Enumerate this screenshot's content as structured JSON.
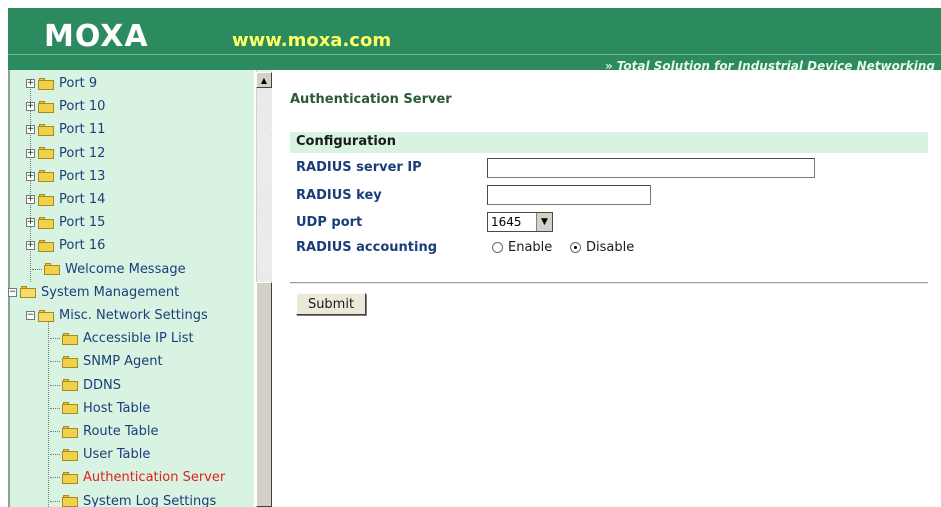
{
  "banner": {
    "logo_text": "MOXA",
    "url": "www.moxa.com",
    "tagline_arrows": "»",
    "tagline": "Total Solution for Industrial Device Networking"
  },
  "tree": {
    "items": [
      {
        "label": "Port 9",
        "active": false
      },
      {
        "label": "Port 10",
        "active": false
      },
      {
        "label": "Port 11",
        "active": false
      },
      {
        "label": "Port 12",
        "active": false
      },
      {
        "label": "Port 13",
        "active": false
      },
      {
        "label": "Port 14",
        "active": false
      },
      {
        "label": "Port 15",
        "active": false
      },
      {
        "label": "Port 16",
        "active": false
      },
      {
        "label": "Welcome Message",
        "active": false
      },
      {
        "label": "System Management",
        "active": false
      },
      {
        "label": "Misc. Network Settings",
        "active": false
      },
      {
        "label": "Accessible IP List",
        "active": false
      },
      {
        "label": "SNMP Agent",
        "active": false
      },
      {
        "label": "DDNS",
        "active": false
      },
      {
        "label": "Host Table",
        "active": false
      },
      {
        "label": "Route Table",
        "active": false
      },
      {
        "label": "User Table",
        "active": false
      },
      {
        "label": "Authentication Server",
        "active": true
      },
      {
        "label": "System Log Settings",
        "active": false
      }
    ]
  },
  "main": {
    "page_title": "Authentication Server",
    "section_header": "Configuration",
    "fields": {
      "radius_ip_label": "RADIUS server IP",
      "radius_ip_value": "",
      "radius_key_label": "RADIUS key",
      "radius_key_value": "",
      "udp_port_label": "UDP port",
      "udp_port_value": "1645",
      "accounting_label": "RADIUS accounting",
      "enable_label": "Enable",
      "disable_label": "Disable",
      "accounting_selected": "Disable"
    },
    "submit_label": "Submit"
  },
  "colors": {
    "banner_green": "#2b8a5e",
    "tree_bg": "#d8f3e2",
    "label_blue": "#1a3e7a",
    "active_red": "#e02020"
  }
}
